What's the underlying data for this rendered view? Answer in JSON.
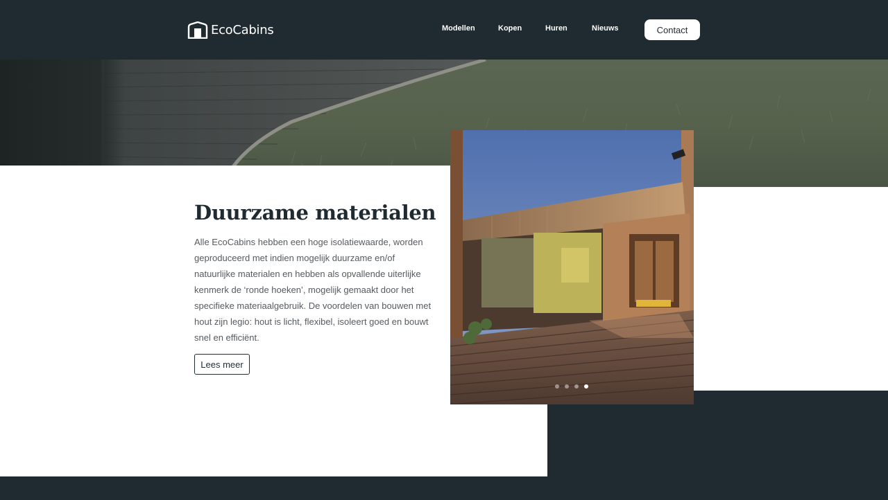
{
  "header": {
    "brand": "EcoCabins",
    "nav": [
      {
        "label": "Modellen"
      },
      {
        "label": "Kopen"
      },
      {
        "label": "Huren"
      },
      {
        "label": "Nieuws"
      }
    ],
    "contact_label": "Contact"
  },
  "section": {
    "title": "Duurzame materialen",
    "body": "Alle EcoCabins hebben een hoge isolatiewaarde, worden geproduceerd met indien mogelijk duurzame en/of natuurlijke materialen en hebben als opvallende uiterlijke kenmerk de ‘ronde hoeken’, mogelijk gemaakt door het specifieke materiaalgebruik. De voordelen van bouwen met hout zijn legio: hout is licht, flexibel, isoleert goed en bouwt snel en efficiënt.",
    "button_label": "Lees meer"
  },
  "carousel": {
    "slide_count": 4,
    "active_slide": 4
  },
  "colors": {
    "dark": "#1f2b31",
    "white": "#ffffff",
    "text_grey": "#555b60"
  }
}
